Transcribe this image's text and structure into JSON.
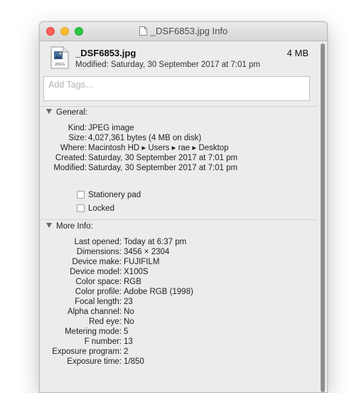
{
  "window": {
    "title": "_DSF6853.jpg Info"
  },
  "header": {
    "icon_label": "JPEG",
    "file_name": "_DSF6853.jpg",
    "size": "4 MB",
    "modified": "Modified: Saturday, 30 September 2017 at 7:01 pm"
  },
  "tags": {
    "placeholder": "Add Tags…"
  },
  "general": {
    "title": "General:",
    "rows": [
      {
        "key": "Kind:",
        "value": "JPEG image"
      },
      {
        "key": "Size:",
        "value": "4,027,361 bytes (4 MB on disk)"
      },
      {
        "key": "Where:",
        "value": "Macintosh HD ▸ Users ▸ rae ▸ Desktop"
      },
      {
        "key": "Created:",
        "value": "Saturday, 30 September 2017 at 7:01 pm"
      },
      {
        "key": "Modified:",
        "value": "Saturday, 30 September 2017 at 7:01 pm"
      }
    ],
    "stationery": "Stationery pad",
    "locked": "Locked"
  },
  "more": {
    "title": "More Info:",
    "rows": [
      {
        "key": "Last opened:",
        "value": "Today at 6:37 pm"
      },
      {
        "key": "Dimensions:",
        "value": "3456 × 2304"
      },
      {
        "key": "Device make:",
        "value": "FUJIFILM"
      },
      {
        "key": "Device model:",
        "value": "X100S"
      },
      {
        "key": "Color space:",
        "value": "RGB"
      },
      {
        "key": "Color profile:",
        "value": "Adobe RGB (1998)"
      },
      {
        "key": "Focal length:",
        "value": "23"
      },
      {
        "key": "Alpha channel:",
        "value": "No"
      },
      {
        "key": "Red eye:",
        "value": "No"
      },
      {
        "key": "Metering mode:",
        "value": "5"
      },
      {
        "key": "F number:",
        "value": "13"
      },
      {
        "key": "Exposure program:",
        "value": "2"
      },
      {
        "key": "Exposure time:",
        "value": "1/850"
      }
    ]
  }
}
